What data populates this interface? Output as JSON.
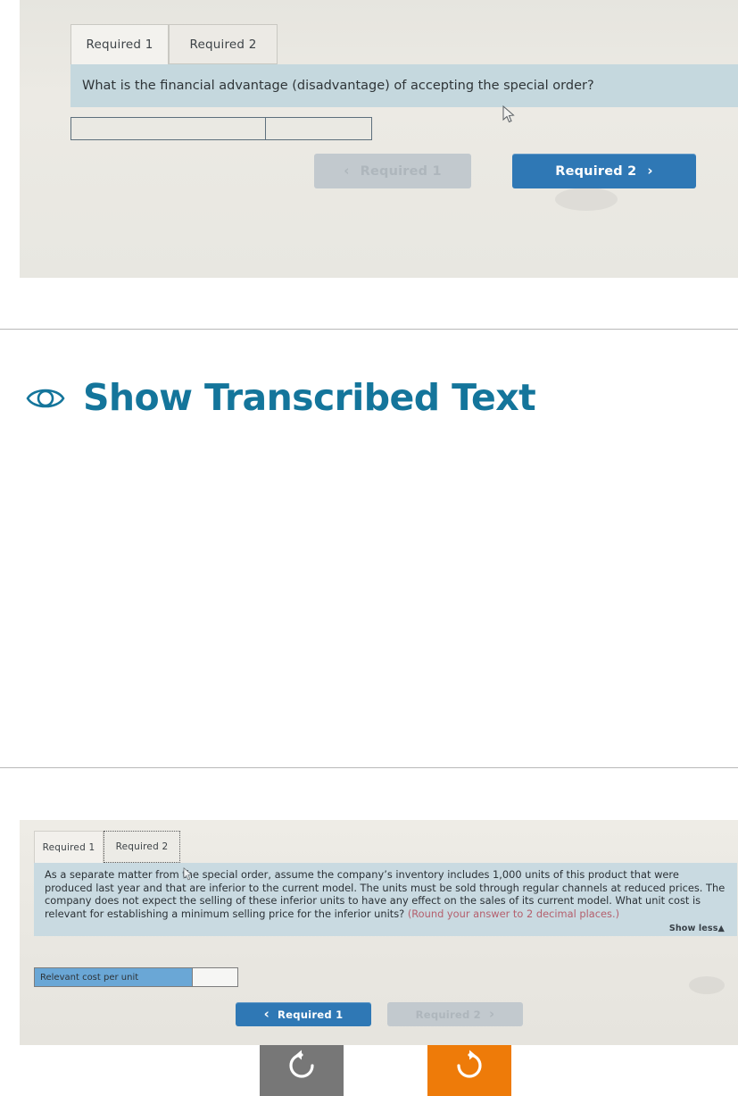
{
  "top_panel": {
    "tabs": [
      {
        "label": "Required 1",
        "state": "active"
      },
      {
        "label": "Required 2",
        "state": "inactive"
      }
    ],
    "question": "What is the financial advantage (disadvantage) of accepting the special order?",
    "answer_row": {
      "label": "",
      "value": ""
    },
    "nav": {
      "prev_label": "Required 1",
      "prev_chevron": "‹",
      "prev_state": "disabled",
      "next_label": "Required 2",
      "next_chevron": "›",
      "next_state": "enabled"
    }
  },
  "transcribe": {
    "title": "Show Transcribed Text",
    "icon": "eye-icon",
    "title_color": "#14759b",
    "buttons": [
      {
        "name": "rotate-counterclockwise",
        "glyph": "↺",
        "background": "#777777"
      },
      {
        "name": "rotate-clockwise",
        "glyph": "↻",
        "background": "#ee7b09"
      }
    ]
  },
  "bottom_panel": {
    "tabs": [
      {
        "label": "Required 1",
        "state": "active"
      },
      {
        "label": "Required 2",
        "state": "focused"
      }
    ],
    "question_part1": "As a separate matter from the special order, assume the company’s inventory includes 1,000 units of this product that were produced last year and that are inferior to the current model. The units must be sold through regular channels at reduced prices. The company does not expect the selling of these inferior units to have any effect on the sales of its current model. What unit cost is relevant for establishing a minimum selling price for the inferior units? ",
    "question_hint": "(Round your answer to 2 decimal places.)",
    "show_less_label": "Show less",
    "show_less_caret": "▲",
    "answer_row": {
      "label": "Relevant cost per unit",
      "value": ""
    },
    "nav": {
      "prev_label": "Required 1",
      "prev_chevron": "‹",
      "prev_state": "enabled",
      "next_label": "Required 2",
      "next_chevron": "›",
      "next_state": "disabled"
    }
  },
  "colors": {
    "accent_blue": "#2f78b5",
    "teal_heading": "#14759b",
    "orange_button": "#ee7b09",
    "gray_button": "#777777",
    "question_band": "#c5d8de",
    "panel_background": "#e9e8e2"
  }
}
